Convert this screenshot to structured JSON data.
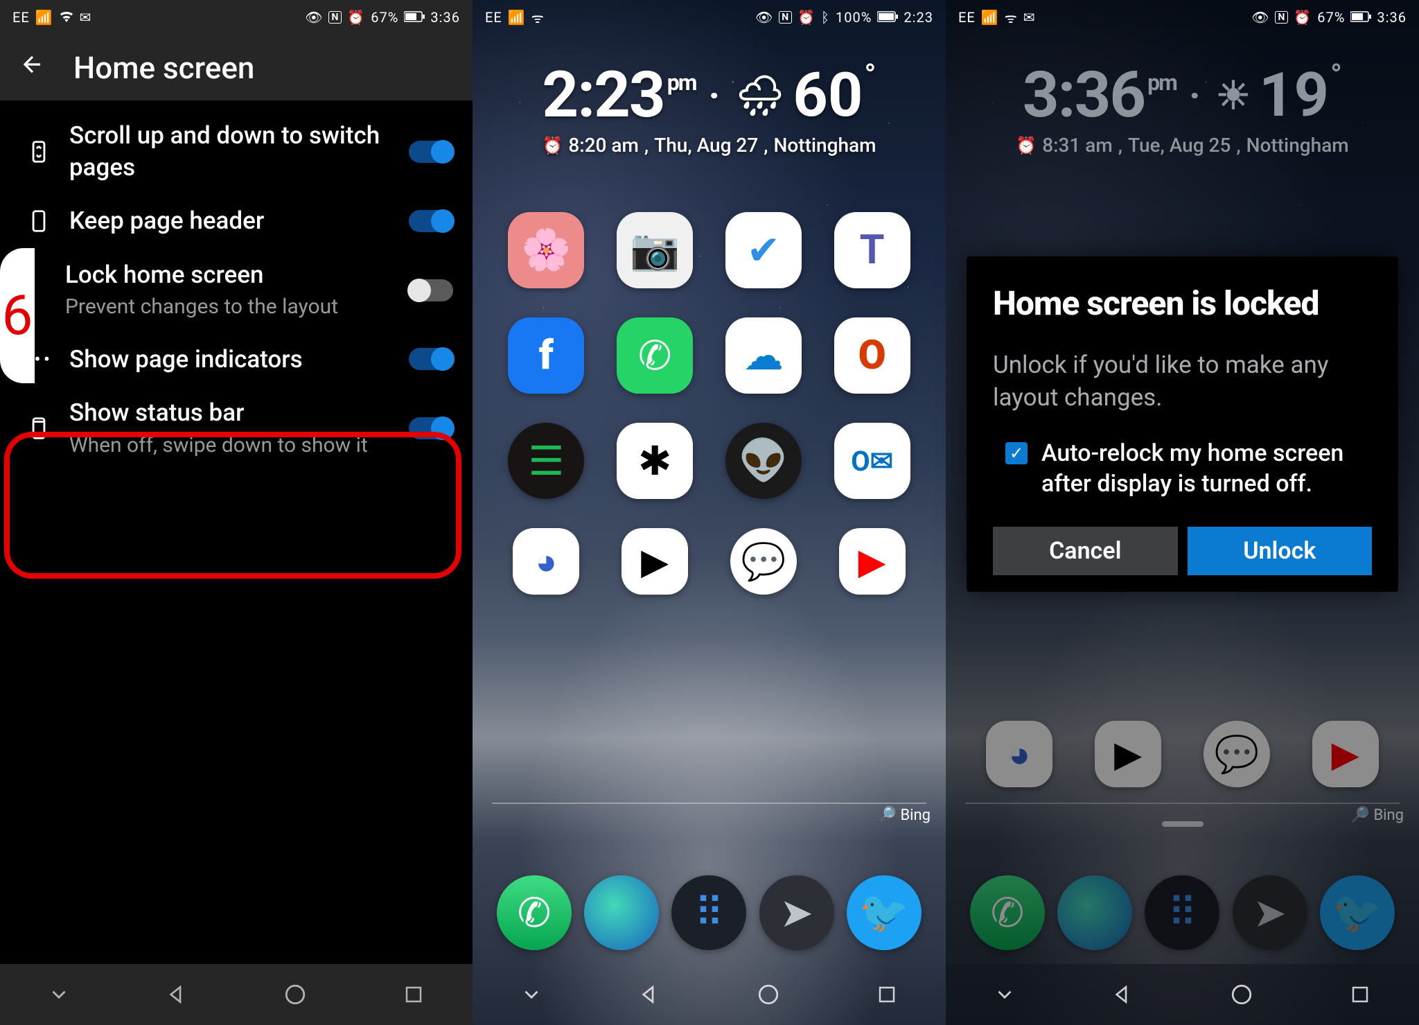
{
  "pane1": {
    "status": {
      "carrier": "EE",
      "battery": "67%",
      "time": "3:36"
    },
    "header": {
      "title": "Home screen"
    },
    "items": [
      {
        "label": "Scroll up and down to switch pages",
        "sub": "",
        "on": true
      },
      {
        "label": "Keep page header",
        "sub": "",
        "on": true
      },
      {
        "label": "Lock home screen",
        "sub": "Prevent changes to the layout",
        "on": false
      },
      {
        "label": "Show page indicators",
        "sub": "",
        "on": true
      },
      {
        "label": "Show status bar",
        "sub": "When off, swipe down to show it",
        "on": true
      }
    ],
    "highlight_badge": "6"
  },
  "pane2": {
    "status": {
      "carrier": "EE",
      "battery": "100%",
      "time": "2:23"
    },
    "clock": {
      "time": "2:23",
      "ampm": "pm",
      "temp": "60",
      "alarm": "8:20 am",
      "day": "Thu, Aug 27",
      "loc": "Nottingham"
    },
    "bing_label": "Bing"
  },
  "pane3": {
    "status": {
      "carrier": "EE",
      "battery": "67%",
      "time": "3:36"
    },
    "clock": {
      "time": "3:36",
      "ampm": "pm",
      "temp": "19",
      "alarm": "8:31 am",
      "day": "Tue, Aug 25",
      "loc": "Nottingham"
    },
    "dialog": {
      "title": "Home screen is locked",
      "body": "Unlock if you'd like to make any layout changes.",
      "checkbox_label": "Auto-relock my home screen after display is turned off.",
      "cancel": "Cancel",
      "unlock": "Unlock"
    },
    "bing_label": "Bing"
  }
}
